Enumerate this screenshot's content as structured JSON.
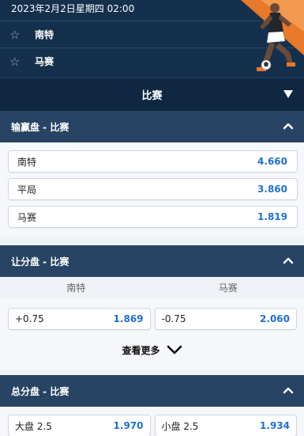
{
  "match": {
    "datetime": "2023年2月2日星期四 02:00",
    "home_team": "南特",
    "away_team": "马赛"
  },
  "section": {
    "title": "比赛"
  },
  "markets": [
    {
      "title": "输赢盘 - 比赛",
      "outcomes": [
        {
          "label": "南特",
          "odds": "4.660"
        },
        {
          "label": "平局",
          "odds": "3.860"
        },
        {
          "label": "马赛",
          "odds": "1.819"
        }
      ]
    },
    {
      "title": "让分盘 - 比赛",
      "columns": [
        "南特",
        "马赛"
      ],
      "outcomes": [
        {
          "label": "+0.75",
          "odds": "1.869"
        },
        {
          "label": "-0.75",
          "odds": "2.060"
        }
      ],
      "more_label": "查看更多"
    },
    {
      "title": "总分盘 - 比赛",
      "outcomes": [
        {
          "label": "大盘 2.5",
          "odds": "1.970"
        },
        {
          "label": "小盘 2.5",
          "odds": "1.934"
        }
      ]
    }
  ],
  "colors": {
    "header_bg": "#15304d",
    "market_header_bg": "#274465",
    "odds_blue": "#1f6fd1",
    "accent_orange": "#e8782a"
  },
  "icons": {
    "favorite": "star-icon",
    "collapse": "chevron-up-icon",
    "expand": "triangle-down-icon",
    "more": "chevron-down-icon"
  }
}
